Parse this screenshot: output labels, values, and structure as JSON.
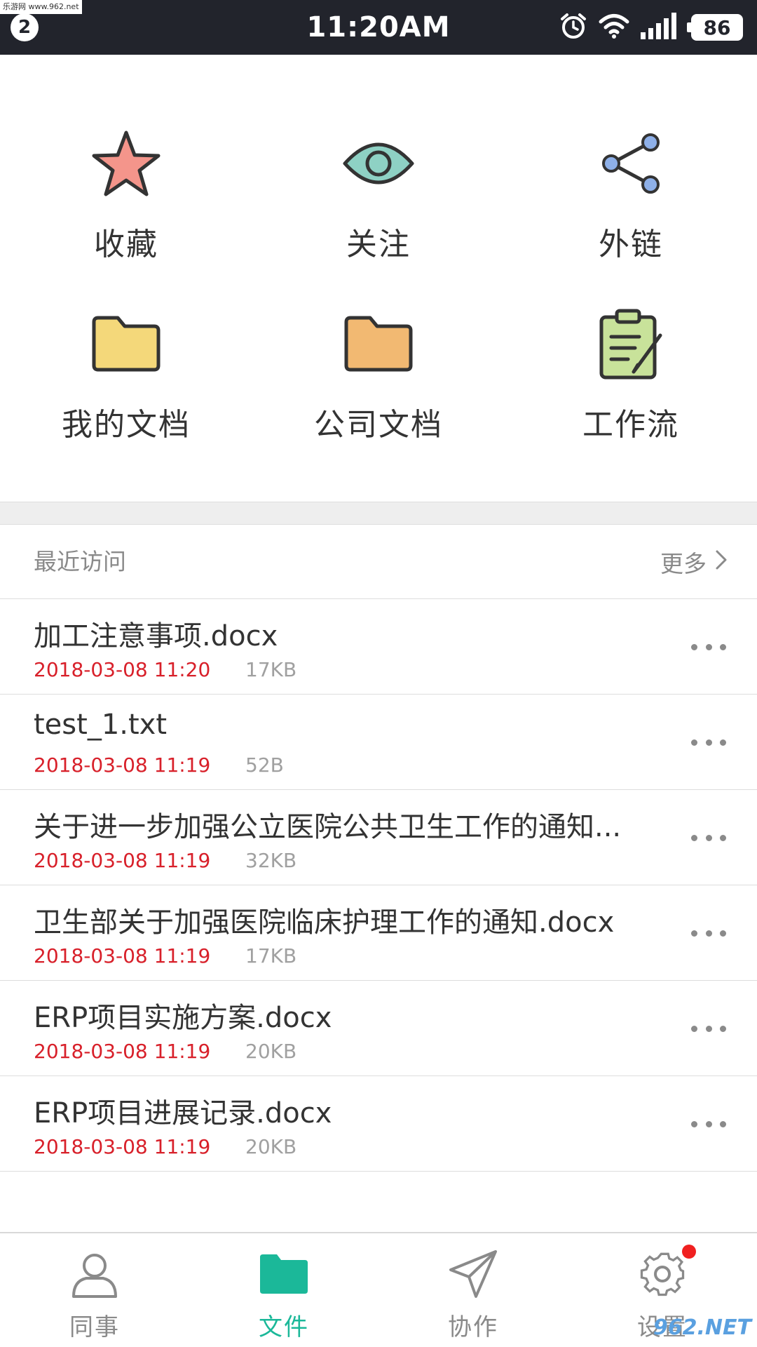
{
  "status_bar": {
    "watermark": "乐游网 www.962.net",
    "notification_count": "2",
    "time": "11:20AM",
    "battery": "86",
    "icons": [
      "alarm-icon",
      "wifi-icon",
      "signal-icon",
      "battery-icon"
    ]
  },
  "quick_access": [
    {
      "label": "收藏",
      "icon": "star-icon",
      "color": "#f4958b"
    },
    {
      "label": "关注",
      "icon": "eye-icon",
      "color": "#8ed1c4"
    },
    {
      "label": "外链",
      "icon": "share-icon",
      "color": "#8eb0e8"
    },
    {
      "label": "我的文档",
      "icon": "folder-icon",
      "color": "#f4d87a"
    },
    {
      "label": "公司文档",
      "icon": "folder-icon",
      "color": "#f2b972"
    },
    {
      "label": "工作流",
      "icon": "clipboard-icon",
      "color": "#c8e29a"
    }
  ],
  "recent": {
    "title": "最近访问",
    "more_label": "更多"
  },
  "files": [
    {
      "name": "加工注意事项.docx",
      "time": "2018-03-08 11:20",
      "size": "17KB"
    },
    {
      "name": "test_1.txt",
      "time": "2018-03-08 11:19",
      "size": "52B"
    },
    {
      "name": "关于进一步加强公立医院公共卫生工作的通知...",
      "time": "2018-03-08 11:19",
      "size": "32KB"
    },
    {
      "name": "卫生部关于加强医院临床护理工作的通知.docx",
      "time": "2018-03-08 11:19",
      "size": "17KB"
    },
    {
      "name": "ERP项目实施方案.docx",
      "time": "2018-03-08 11:19",
      "size": "20KB"
    },
    {
      "name": "ERP项目进展记录.docx",
      "time": "2018-03-08 11:19",
      "size": "20KB"
    }
  ],
  "tabs": [
    {
      "label": "同事",
      "icon": "person-icon",
      "active": false
    },
    {
      "label": "文件",
      "icon": "folder-icon",
      "active": true
    },
    {
      "label": "协作",
      "icon": "paper-plane-icon",
      "active": false
    },
    {
      "label": "设置",
      "icon": "gear-icon",
      "active": false,
      "badge": true
    }
  ],
  "watermark_bottom": "962.NET",
  "colors": {
    "accent": "#1bb899",
    "status_bar": "#22242c",
    "time_text": "#d8202a",
    "badge": "#f02020"
  }
}
